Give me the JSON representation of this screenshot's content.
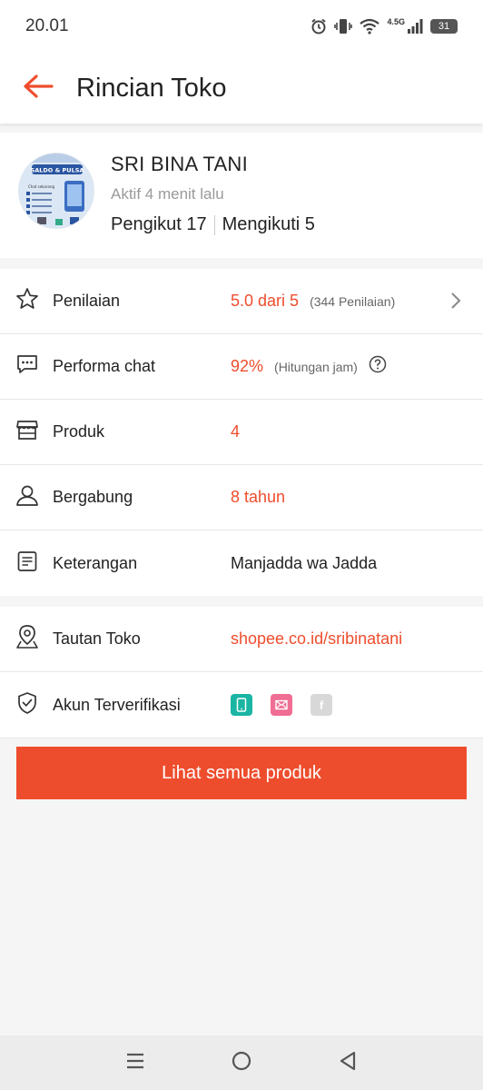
{
  "status_bar": {
    "time": "20.01",
    "network": "4.5G",
    "battery": "31"
  },
  "header": {
    "title": "Rincian Toko",
    "back_icon": "arrow-left-icon"
  },
  "shop": {
    "name": "SRI BINA TANI",
    "active": "Aktif 4 menit lalu",
    "followers": "Pengikut 17",
    "following": "Mengikuti 5",
    "avatar_banner_top": "SALDO & PULSA",
    "avatar_banner_label": "Chat sekarang"
  },
  "info": [
    {
      "icon": "star-icon",
      "label": "Penilaian",
      "value": "5.0 dari 5",
      "sub": "(344 Penilaian)",
      "accent": true
    },
    {
      "icon": "chat-icon",
      "label": "Performa chat",
      "value": "92%",
      "sub": "(Hitungan jam)",
      "accent": true
    },
    {
      "icon": "store-icon",
      "label": "Produk",
      "value": "4",
      "accent": true
    },
    {
      "icon": "user-icon",
      "label": "Bergabung",
      "value": "8 tahun",
      "accent": true
    },
    {
      "icon": "note-icon",
      "label": "Keterangan",
      "value": "Manjadda wa Jadda",
      "accent": false
    }
  ],
  "info2": [
    {
      "icon": "location-icon",
      "label": "Tautan Toko",
      "value": "shopee.co.id/sribinatani"
    },
    {
      "icon": "shield-check-icon",
      "label": "Akun Terverifikasi"
    }
  ],
  "verify_icons": [
    "phone-icon",
    "email-icon",
    "facebook-icon"
  ],
  "verify_fb_letter": "f",
  "cta_label": "Lihat semua produk",
  "colors": {
    "accent": "#ee4d2d",
    "phone_badge": "#1bb5a3",
    "email_badge": "#f06d93",
    "fb_badge": "#d8d8d8"
  },
  "nav": [
    "menu-icon",
    "home-icon",
    "back-triangle-icon"
  ]
}
